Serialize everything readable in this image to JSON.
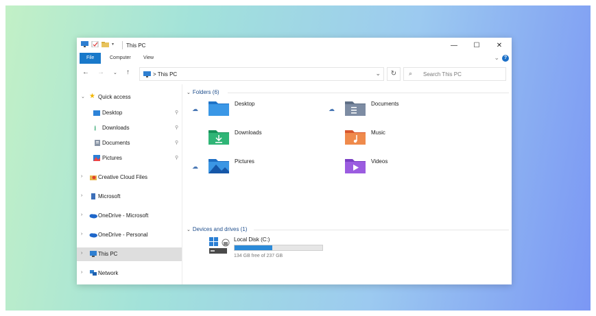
{
  "window": {
    "title": "This PC",
    "controls": {
      "minimize": "—",
      "maximize": "☐",
      "close": "✕"
    }
  },
  "ribbon": {
    "tabs": [
      "File",
      "Computer",
      "View"
    ]
  },
  "address": {
    "crumb_separator": ">",
    "crumb": "This PC",
    "search_placeholder": "Search This PC"
  },
  "nav": {
    "items": [
      {
        "label": "Quick access",
        "icon": "star-icon",
        "expanded": true
      },
      {
        "label": "Desktop",
        "icon": "desktop-folder-icon",
        "pinned": true
      },
      {
        "label": "Downloads",
        "icon": "downloads-icon",
        "pinned": true
      },
      {
        "label": "Documents",
        "icon": "documents-icon",
        "pinned": true
      },
      {
        "label": "Pictures",
        "icon": "pictures-icon",
        "pinned": true
      },
      {
        "label": "Creative Cloud Files",
        "icon": "creative-cloud-icon"
      },
      {
        "label": "Microsoft",
        "icon": "microsoft-icon"
      },
      {
        "label": "OneDrive - Microsoft",
        "icon": "onedrive-icon"
      },
      {
        "label": "OneDrive - Personal",
        "icon": "onedrive-icon"
      },
      {
        "label": "This PC",
        "icon": "this-pc-icon",
        "selected": true
      },
      {
        "label": "Network",
        "icon": "network-icon"
      }
    ]
  },
  "content": {
    "folders_header": "Folders (6)",
    "folders": [
      {
        "label": "Desktop",
        "icon": "desktop-folder-icon",
        "cloud": true
      },
      {
        "label": "Documents",
        "icon": "documents-folder-icon",
        "cloud": true
      },
      {
        "label": "Downloads",
        "icon": "downloads-folder-icon",
        "cloud": false
      },
      {
        "label": "Music",
        "icon": "music-folder-icon",
        "cloud": false
      },
      {
        "label": "Pictures",
        "icon": "pictures-folder-icon",
        "cloud": true
      },
      {
        "label": "Videos",
        "icon": "videos-folder-icon",
        "cloud": false
      }
    ],
    "devices_header": "Devices and drives (1)",
    "drive": {
      "label": "Local Disk (C:)",
      "free_text": "134 GB free of 237 GB",
      "used_fraction": 0.43
    }
  },
  "colors": {
    "accent": "#1979ca",
    "selection": "#dedede",
    "drive_bar": "#2b8ad8"
  }
}
